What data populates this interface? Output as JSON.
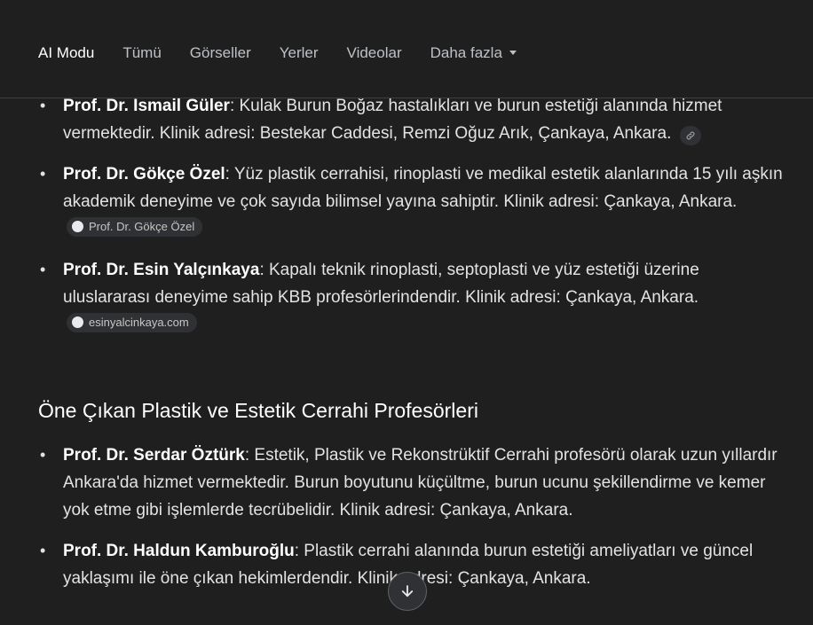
{
  "nav": {
    "tabs": [
      "AI Modu",
      "Tümü",
      "Görseller",
      "Yerler",
      "Videolar",
      "Daha fazla"
    ]
  },
  "list1": [
    {
      "name": "Prof. Dr. İsmail Güler",
      "text": ": Kulak Burun Boğaz hastalıkları ve burun estetiği alanında hizmet vermektedir. Klinik adresi: Bestekar Caddesi, Remzi Oğuz Arık, Çankaya, Ankara."
    },
    {
      "name": "Prof. Dr. Gökçe Özel",
      "text": ": Yüz plastik cerrahisi, rinoplasti ve medikal estetik alanlarında 15 yılı aşkın akademik deneyime ve çok sayıda bilimsel yayına sahiptir. Klinik adresi: Çankaya, Ankara.",
      "source": "Prof. Dr. Gökçe Özel"
    },
    {
      "name": "Prof. Dr. Esin Yalçınkaya",
      "text": ": Kapalı teknik rinoplasti, septoplasti ve yüz estetiği üzerine uluslararası deneyime sahip KBB profesörlerindendir. Klinik adresi: Çankaya, Ankara.",
      "source": "esinyalcinkaya.com"
    }
  ],
  "section2": {
    "heading": "Öne Çıkan Plastik ve Estetik Cerrahi Profesörleri",
    "items": [
      {
        "name": "Prof. Dr. Serdar Öztürk",
        "text": ": Estetik, Plastik ve Rekonstrüktif Cerrahi profesörü olarak uzun yıllardır Ankara'da hizmet vermektedir. Burun boyutunu küçültme, burun ucunu şekillendirme ve kemer yok etme gibi işlemlerde tecrübelidir. Klinik adresi: Çankaya, Ankara."
      },
      {
        "name": "Prof. Dr. Haldun Kamburoğlu",
        "text": ": Plastik cerrahi alanında burun estetiği ameliyatları ve güncel yaklaşımı ile öne çıkan hekimlerdendir. Klinik adresi: Çankaya, Ankara."
      }
    ]
  },
  "icons": {
    "link": "link-icon",
    "scroll": "arrow-down-icon"
  }
}
